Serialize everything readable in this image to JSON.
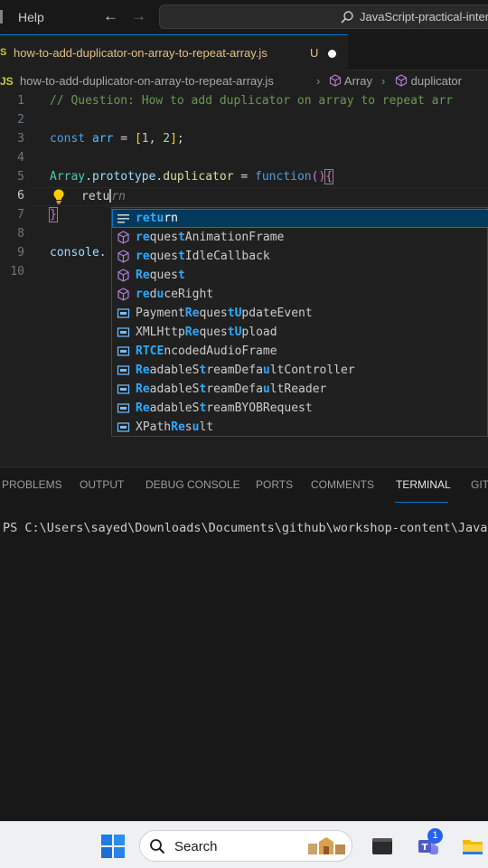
{
  "titlebar": {
    "menu_help": "Help",
    "search_text": "JavaScript-practical-inter"
  },
  "tab": {
    "file_name": "how-to-add-duplicator-on-array-to-repeat-array.js",
    "status": "U"
  },
  "breadcrumb": {
    "lang": "JS",
    "file": "how-to-add-duplicator-on-array-to-repeat-array.js",
    "symbol1": "Array",
    "symbol2": "duplicator"
  },
  "editor": {
    "line_numbers": [
      "1",
      "2",
      "3",
      "4",
      "5",
      "6",
      "7",
      "8",
      "9",
      "10"
    ],
    "lines": {
      "l1_comment": "// Question: How to add duplicator on array to repeat arr",
      "l3_const": "const",
      "l3_var": "arr",
      "l3_eq": " = ",
      "l3_open": "[",
      "l3_n1": "1",
      "l3_comma": ", ",
      "l3_n2": "2",
      "l3_close": "]",
      "l3_semi": ";",
      "l5_array": "Array",
      "l5_dot1": ".",
      "l5_proto": "prototype",
      "l5_dot2": ".",
      "l5_dup": "duplicator",
      "l5_eq": " = ",
      "l5_function": "function",
      "l5_parens": "()",
      "l5_brace": "{",
      "l6_typed": "retu",
      "l6_ghost": "rn",
      "l7_brace": "}",
      "l9_console": "console."
    }
  },
  "suggestions": [
    {
      "pre": "",
      "hl": "retu",
      "mid": "",
      "hl2": "",
      "post": "rn",
      "kind": "keyword"
    },
    {
      "pre": "",
      "hl": "re",
      "mid": "ques",
      "hl2": "t",
      "post": "AnimationFrame",
      "kind": "method"
    },
    {
      "pre": "",
      "hl": "re",
      "mid": "ques",
      "hl2": "t",
      "post": "IdleCallback",
      "kind": "method"
    },
    {
      "pre": "",
      "hl": "Re",
      "mid": "ques",
      "hl2": "t",
      "post": "",
      "kind": "method"
    },
    {
      "pre": "",
      "hl": "re",
      "mid": "d",
      "hl2": "u",
      "post": "ceRight",
      "kind": "method"
    },
    {
      "pre": "Payment",
      "hl": "Re",
      "mid": "ques",
      "hl2": "tU",
      "post": "pdateEvent",
      "kind": "variable"
    },
    {
      "pre": "XMLHttp",
      "hl": "Re",
      "mid": "ques",
      "hl2": "tU",
      "post": "pload",
      "kind": "variable"
    },
    {
      "pre": "",
      "hl": "R",
      "mid": "",
      "hl2": "TCE",
      "post": "ncodedAudioFrame",
      "kind": "variable"
    },
    {
      "pre": "",
      "hl": "Re",
      "mid": "adableS",
      "hl2": "t",
      "post": "reamDefa|u|ltController",
      "kind": "variable"
    },
    {
      "pre": "",
      "hl": "Re",
      "mid": "adableS",
      "hl2": "t",
      "post": "reamDefa|u|ltReader",
      "kind": "variable"
    },
    {
      "pre": "",
      "hl": "Re",
      "mid": "adableS",
      "hl2": "t",
      "post": "reamBYOBRequest",
      "kind": "variable"
    },
    {
      "pre": "XPath",
      "hl": "Re",
      "mid": "s",
      "hl2": "u",
      "post": "lt",
      "kind": "variable"
    }
  ],
  "suggestion_labels": [
    "return",
    "requestAnimationFrame",
    "requestIdleCallback",
    "Request",
    "reduceRight",
    "PaymentRequestUpdateEvent",
    "XMLHttpRequestUpload",
    "RTCEncodedAudioFrame",
    "ReadableStreamDefaultController",
    "ReadableStreamDefaultReader",
    "ReadableStreamBYOBRequest",
    "XPathResult"
  ],
  "panel": {
    "tabs": [
      "PROBLEMS",
      "OUTPUT",
      "DEBUG CONSOLE",
      "PORTS",
      "COMMENTS",
      "TERMINAL",
      "GIT"
    ],
    "active_tab": "TERMINAL",
    "terminal_line": "PS C:\\Users\\sayed\\Downloads\\Documents\\github\\workshop-content\\JavaSc"
  },
  "taskbar": {
    "search_label": "Search",
    "teams_badge": "1"
  },
  "colors": {
    "accent": "#0078d4",
    "modified_file": "#e2c08d",
    "match_highlight": "#2aaaff"
  }
}
